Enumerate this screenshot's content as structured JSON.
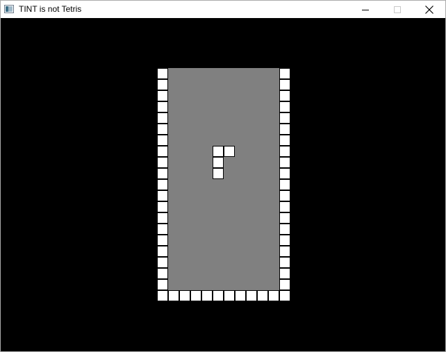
{
  "window": {
    "title": "TINT is not Tetris",
    "icon": "window-app-icon",
    "controls": {
      "minimize_icon": "minimize-icon",
      "maximize_icon": "maximize-icon",
      "close_icon": "close-icon"
    }
  },
  "game": {
    "board_columns": 10,
    "board_rows": 20,
    "colors": {
      "background": "#000000",
      "playfield": "#808080",
      "wall_block": "#ffffff",
      "piece_block": "#ffffff",
      "block_border": "#000000"
    },
    "active_piece": {
      "shape": "L",
      "cells": [
        [
          4,
          7
        ],
        [
          5,
          7
        ],
        [
          4,
          8
        ],
        [
          4,
          9
        ]
      ]
    }
  }
}
